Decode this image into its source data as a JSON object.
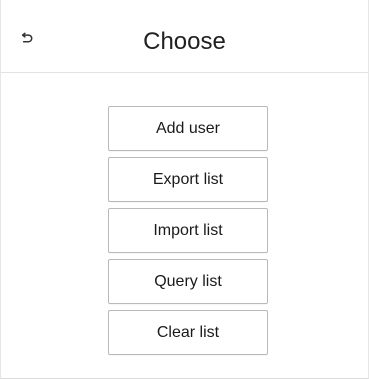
{
  "header": {
    "title": "Choose",
    "back_icon": "undo-arrow-icon"
  },
  "menu": {
    "items": [
      {
        "label": "Add user"
      },
      {
        "label": "Export list"
      },
      {
        "label": "Import list"
      },
      {
        "label": "Query list"
      },
      {
        "label": "Clear list"
      }
    ]
  }
}
